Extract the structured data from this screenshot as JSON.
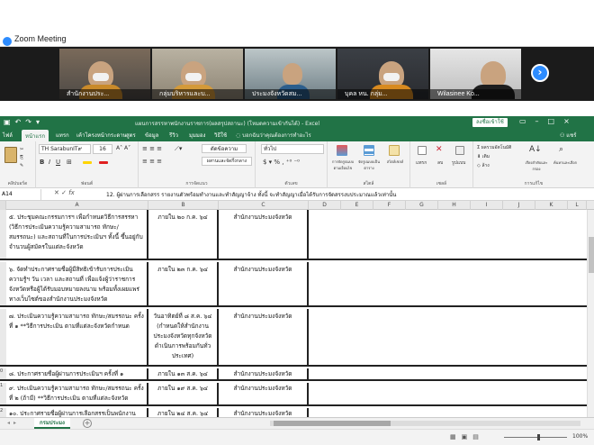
{
  "zoom": {
    "title": "Zoom Meeting",
    "participants": [
      {
        "name": "สำนักงานประ..."
      },
      {
        "name": "กลุ่มบริหารและบ..."
      },
      {
        "name": "ประมงจังหวัดสม..."
      },
      {
        "name": "บุคล หน. กลุ่ม..."
      },
      {
        "name": "Wilasinee Ko..."
      }
    ],
    "next_icon": "chevron-right-icon",
    "accent": "#2d8cff"
  },
  "excel": {
    "accent": "#217346",
    "window_title": "แผนการสรรหาพนักงานราชการ(ผลสรุปสถานะ) (โหมดความเข้ากันได้) - Excel",
    "signin_label": "ลงชื่อเข้าใช้",
    "tabs": [
      "ไฟล์",
      "หน้าแรก",
      "แทรก",
      "เค้าโครงหน้ากระดาษ",
      "สูตร",
      "ข้อมูล",
      "รีวิว",
      "มุมมอง",
      "วิธีใช้"
    ],
    "tell_me": "บอกฉันว่าคุณต้องการทำอะไร",
    "share_label": "แชร์",
    "ribbon": {
      "clipboard_label": "คลิปบอร์ด",
      "font_name": "TH SarabunIT๙",
      "font_size": "16",
      "font_label": "ฟอนต์",
      "wrap_text": "ตัดข้อความ",
      "merge_center": "ผสานและจัดกึ่งกลาง",
      "alignment_label": "การจัดแนว",
      "number_format": "ทั่วไป",
      "number_label": "ตัวเลข",
      "conditional_format": "การจัดรูปแบบตามเงื่อนไข",
      "format_as_table": "จัดรูปแบบเป็นตาราง",
      "cell_styles": "สไตล์เซลล์",
      "styles_label": "สไตล์",
      "insert": "แทรก",
      "delete": "ลบ",
      "format": "รูปแบบ",
      "cells_label": "เซลล์",
      "autosum": "ผลรวมอัตโนมัติ",
      "fill": "เติม",
      "clear": "ล้าง",
      "sort_filter": "เรียงลำดับและกรอง",
      "find_select": "ค้นหาและเลือก",
      "editing_label": "การแก้ไข"
    },
    "name_box": "A14",
    "formula": "12. ผู้ผ่านการเลือกสรร รายงานตัวพร้อมทำงานและทำสัญญาจ้าง ทั้งนี้ จะทำสัญญาเมื่อได้รับการจัดสรรงบประมาณแล้วเท่านั้น",
    "columns": [
      "A",
      "B",
      "C",
      "D",
      "E",
      "F",
      "G",
      "H",
      "I",
      "J",
      "K",
      "L"
    ],
    "rows": [
      {
        "num": "",
        "a": "๕. ประชุมคณะกรรมการฯ เพื่อกำหนดวิธีการสรรหา (วิธีการประเมินความรู้ความสามารถ ทักษะ/สมรรถนะ) และสถานที่ในการประเมินฯ ทั้งนี้ ขึ้นอยู่กับจำนวนผู้สมัครในแต่ละจังหวัด",
        "b": "ภายใน ๒๐ ก.ค. ๖๔",
        "c": "สำนักงานประมงจังหวัด"
      },
      {
        "num": "",
        "a": "๖. จัดทำประกาศรายชื่อผู้มีสิทธิเข้ารับการประเมินความรู้ฯ วัน เวลา และสถานที่ เพื่อแจ้งผู้ว่าราชการจังหวัดหรือผู้ได้รับมอบหมายลงนาม พร้อมทั้งเผยแพร่ทางเว็บไซต์ของสำนักงานประมงจังหวัด",
        "b": "ภายใน ๒๓ ก.ค. ๖๔",
        "c": "สำนักงานประมงจังหวัด"
      },
      {
        "num": "",
        "a": "๗. ประเมินความรู้ความสามารถ ทักษะ/สมรรถนะ ครั้งที่ ๑ **วิธีการประเมิน ตามที่แต่ละจังหวัดกำหนด",
        "b": "วันอาทิตย์ที่ ๘ ส.ค. ๖๔ (กำหนดให้สำนักงานประมงจังหวัดทุกจังหวัด ดำเนินการพร้อมกันทั่วประเทศ)",
        "c": "สำนักงานประมงจังหวัด"
      },
      {
        "num": "0",
        "a": "๘. ประกาศรายชื่อผู้ผ่านการประเมินฯ ครั้งที่ ๑",
        "b": "ภายใน ๑๓ ส.ค. ๖๔",
        "c": "สำนักงานประมงจังหวัด"
      },
      {
        "num": "1",
        "a": "๙. ประเมินความรู้ความสามารถ ทักษะ/สมรรถนะ ครั้งที่ ๒ (ถ้ามี) **วิธีการประเมิน ตามที่แต่ละจังหวัดกำหนด",
        "b": "ภายใน ๑๙ ส.ค. ๖๔",
        "c": "สำนักงานประมงจังหวัด"
      },
      {
        "num": "2",
        "a": "๑๐. ประกาศรายชื่อผู้ผ่านการเลือกสรรเป็นพนักงาน",
        "b": "ภายใน ๒๔ ส.ค. ๖๔",
        "c": "สำนักงานประมงจังหวัด"
      }
    ],
    "sheet_name": "กรมประมง",
    "zoom_level": "100%"
  }
}
